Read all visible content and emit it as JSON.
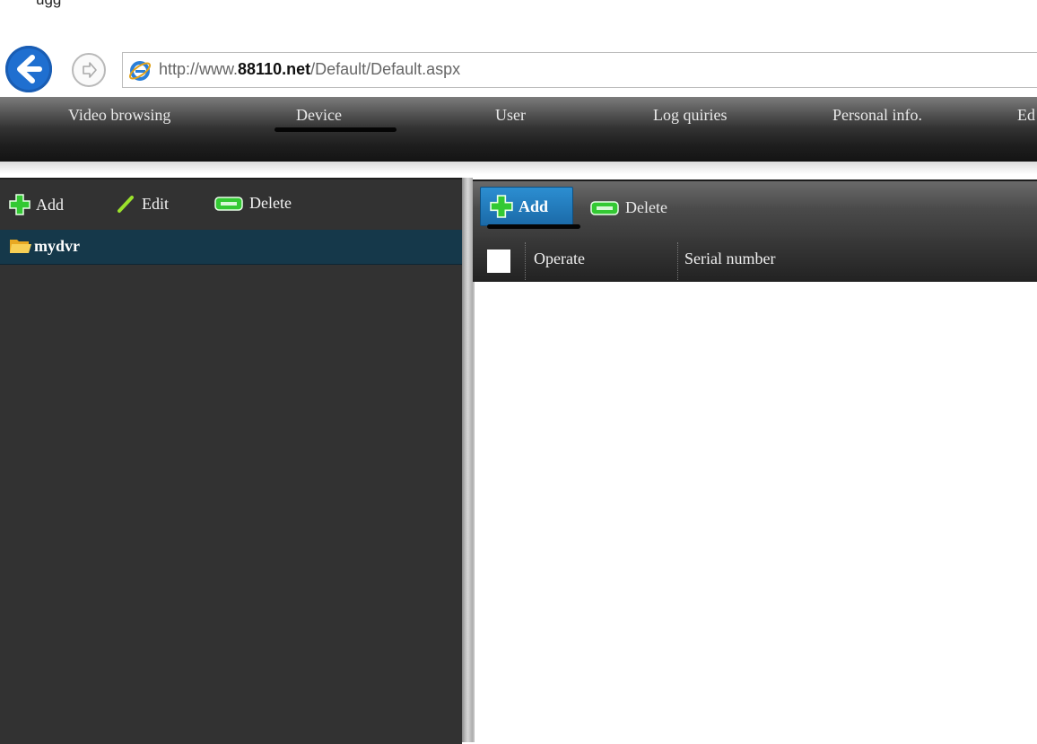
{
  "top_partial_text": "ugg",
  "browser": {
    "url_prefix": "http://www.",
    "url_domain": "88110.net",
    "url_path": "/Default/Default.aspx"
  },
  "nav": {
    "items": [
      "Video browsing",
      "Device",
      "User",
      "Log quiries",
      "Personal info.",
      "Ed"
    ],
    "active": "Device"
  },
  "left_toolbar": {
    "add_label": "Add",
    "edit_label": "Edit",
    "delete_label": "Delete"
  },
  "tree": {
    "items": [
      {
        "label": "mydvr"
      }
    ]
  },
  "right_toolbar": {
    "add_label": "Add",
    "delete_label": "Delete"
  },
  "grid": {
    "columns": [
      "Operate",
      "Serial number"
    ],
    "rows": []
  },
  "colors": {
    "accent_blue": "#1f6fd0",
    "icon_green": "#2fbf2f",
    "tree_selected": "#15384a",
    "add_button": "#2c8ed1"
  }
}
